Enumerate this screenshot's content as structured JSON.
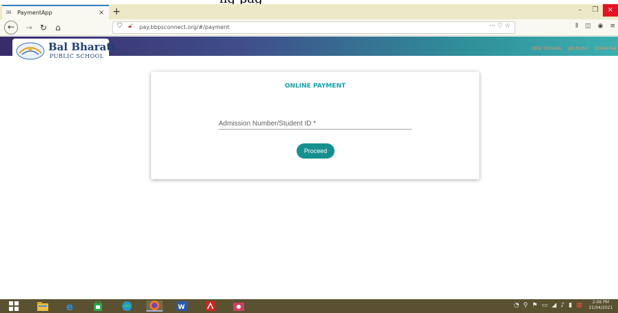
{
  "clipped_heading": "ng pag",
  "browser": {
    "tab_title": "PaymentApp",
    "tab_close": "×",
    "new_tab": "+",
    "url": "pay.bbpsconnect.org/#/payment",
    "url_actions": "··· ♡ ☆",
    "window_controls": [
      "–",
      "❐",
      "×"
    ]
  },
  "site": {
    "logo_title": "Bal Bharati",
    "logo_subtitle": "PUBLIC SCHOOL",
    "header_links": [
      "CBSE Circulars",
      "Job Portal",
      "Online Fee"
    ]
  },
  "payment": {
    "title": "ONLINE PAYMENT",
    "field_placeholder": "Admission Number/Student ID *",
    "field_value": "",
    "proceed_label": "Proceed"
  },
  "taskbar": {
    "clock_time": "2:06 PM",
    "clock_date": "21/04/2021"
  },
  "colors": {
    "accent": "#14908f",
    "title": "#17a1ad",
    "header_gradient_start": "#3a2b6a",
    "header_gradient_end": "#3bb0b0",
    "taskbar": "#5a5130"
  }
}
